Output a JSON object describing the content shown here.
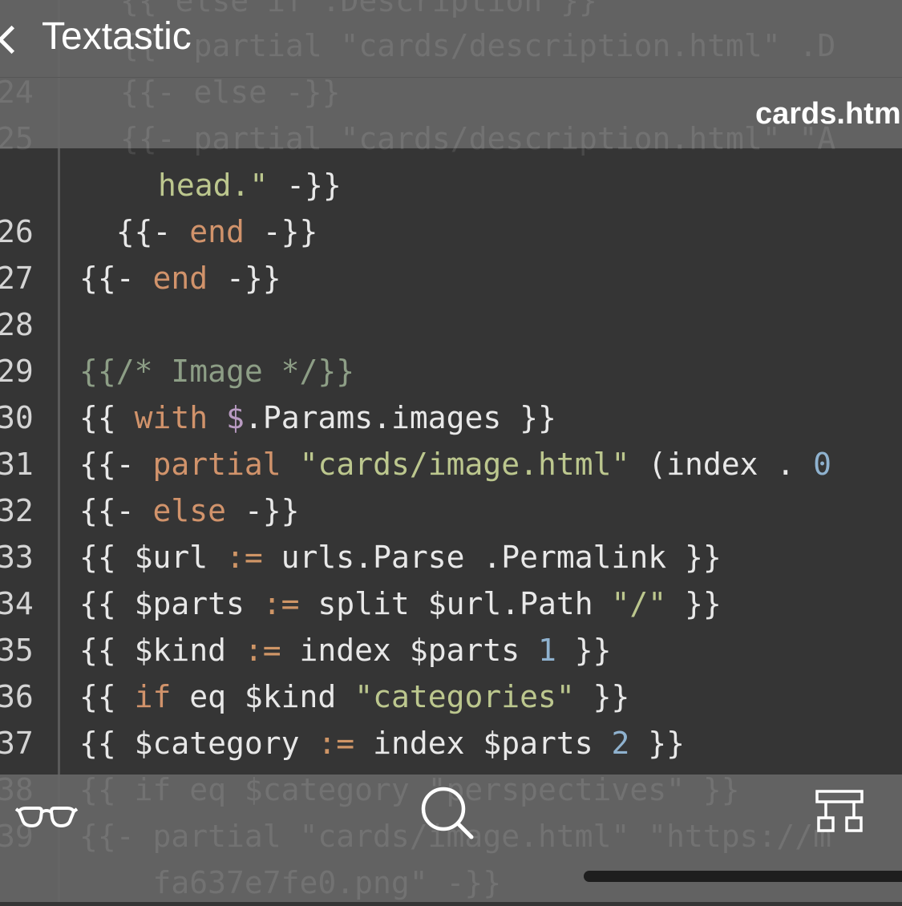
{
  "nav": {
    "back_label": "Textastic",
    "file_title": "cards.htm"
  },
  "header_ghost": [
    {
      "ln": "",
      "text": "{{ else if .Description }}"
    },
    {
      "ln": "",
      "text": "{{- partial \"cards/description.html\" .D"
    },
    {
      "ln": "24",
      "text": "{{- else -}}"
    },
    {
      "ln": "25",
      "text": "{{- partial \"cards/description.html\" \"A"
    }
  ],
  "code_lines": [
    {
      "ln": "",
      "tokens": [
        {
          "t": "head.\"",
          "c": "str"
        },
        {
          "t": " -}}",
          "c": "plain"
        }
      ]
    },
    {
      "ln": "26",
      "tokens": [
        {
          "t": "  {{- ",
          "c": "plain"
        },
        {
          "t": "end",
          "c": "kw"
        },
        {
          "t": " -}}",
          "c": "plain"
        }
      ]
    },
    {
      "ln": "27",
      "tokens": [
        {
          "t": "{{- ",
          "c": "plain"
        },
        {
          "t": "end",
          "c": "kw"
        },
        {
          "t": " -}}",
          "c": "plain"
        }
      ]
    },
    {
      "ln": "28",
      "tokens": []
    },
    {
      "ln": "29",
      "tokens": [
        {
          "t": "{{/* Image */}}",
          "c": "cmt"
        }
      ]
    },
    {
      "ln": "30",
      "tokens": [
        {
          "t": "{{ ",
          "c": "plain"
        },
        {
          "t": "with",
          "c": "kw"
        },
        {
          "t": " ",
          "c": "plain"
        },
        {
          "t": "$",
          "c": "dollar"
        },
        {
          "t": ".Params.images }}",
          "c": "plain"
        }
      ]
    },
    {
      "ln": "31",
      "tokens": [
        {
          "t": "{{- ",
          "c": "plain"
        },
        {
          "t": "partial",
          "c": "kw"
        },
        {
          "t": " ",
          "c": "plain"
        },
        {
          "t": "\"cards/image.html\"",
          "c": "str"
        },
        {
          "t": " (index . ",
          "c": "plain"
        },
        {
          "t": "0",
          "c": "num"
        }
      ]
    },
    {
      "ln": "32",
      "tokens": [
        {
          "t": "{{- ",
          "c": "plain"
        },
        {
          "t": "else",
          "c": "kw"
        },
        {
          "t": " -}}",
          "c": "plain"
        }
      ]
    },
    {
      "ln": "33",
      "tokens": [
        {
          "t": "{{ $url ",
          "c": "plain"
        },
        {
          "t": ":=",
          "c": "op"
        },
        {
          "t": " urls.Parse .Permalink }}",
          "c": "plain"
        }
      ]
    },
    {
      "ln": "34",
      "tokens": [
        {
          "t": "{{ $parts ",
          "c": "plain"
        },
        {
          "t": ":=",
          "c": "op"
        },
        {
          "t": " split $url.Path ",
          "c": "plain"
        },
        {
          "t": "\"/\"",
          "c": "str"
        },
        {
          "t": " }}",
          "c": "plain"
        }
      ]
    },
    {
      "ln": "35",
      "tokens": [
        {
          "t": "{{ $kind ",
          "c": "plain"
        },
        {
          "t": ":=",
          "c": "op"
        },
        {
          "t": " index $parts ",
          "c": "plain"
        },
        {
          "t": "1",
          "c": "num"
        },
        {
          "t": " }}",
          "c": "plain"
        }
      ]
    },
    {
      "ln": "36",
      "tokens": [
        {
          "t": "{{ ",
          "c": "plain"
        },
        {
          "t": "if",
          "c": "kw"
        },
        {
          "t": " eq $kind ",
          "c": "plain"
        },
        {
          "t": "\"categories\"",
          "c": "str"
        },
        {
          "t": " }}",
          "c": "plain"
        }
      ]
    },
    {
      "ln": "37",
      "tokens": [
        {
          "t": "{{ $category ",
          "c": "plain"
        },
        {
          "t": ":=",
          "c": "op"
        },
        {
          "t": " index $parts ",
          "c": "plain"
        },
        {
          "t": "2",
          "c": "num"
        },
        {
          "t": " }}",
          "c": "plain"
        }
      ]
    }
  ],
  "footer_ghost": [
    {
      "ln": "38",
      "text": "{{ if eq $category \"perspectives\" }}"
    },
    {
      "ln": "39",
      "text": "{{- partial \"cards/image.html\" \"https://m"
    },
    {
      "ln": "",
      "text": "    fa637e7fe0.png\" -}}"
    }
  ],
  "toolbar": {
    "icons": [
      "glasses-icon",
      "search-icon",
      "symbol-tree-icon"
    ]
  },
  "colors": {
    "background": "#353535",
    "bar": "#666666",
    "keyword": "#d1936b",
    "string": "#bcc78e",
    "number": "#8fb2cf",
    "comment": "#8d9e86"
  }
}
